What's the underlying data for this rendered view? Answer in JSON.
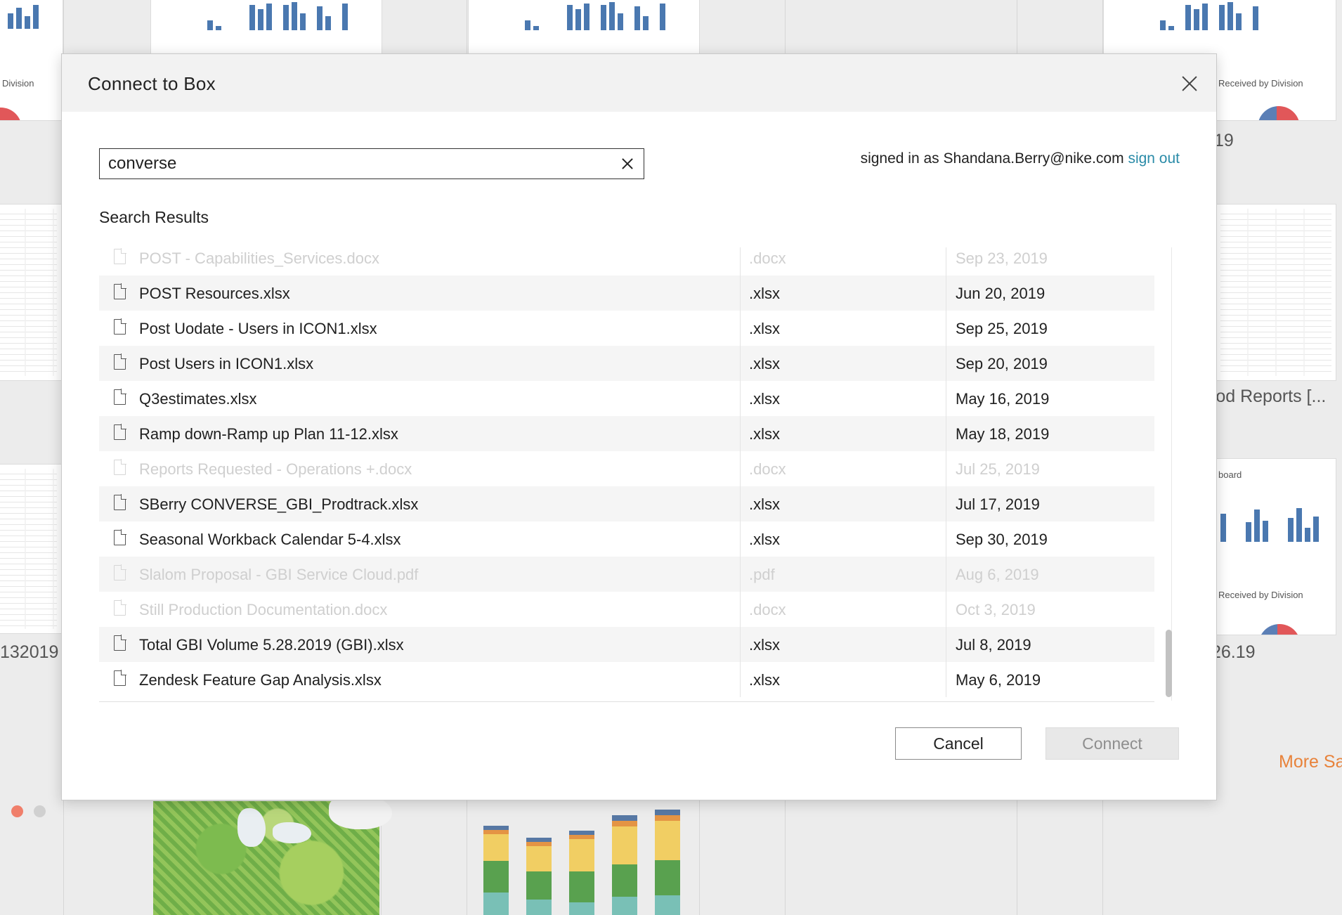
{
  "background": {
    "left_chart_label": "Division",
    "right_chart_label_1": "Received by Division",
    "right_value_1": ".19",
    "right_workbook_label": "rod Reports [...",
    "right_board_label": "board",
    "right_chart_label_2": "Received by Division",
    "right_value_2": "26.19",
    "left_value": "132019",
    "more_samples": "More Sa"
  },
  "dialog": {
    "title": "Connect to Box",
    "close_icon": "close-icon",
    "search": {
      "value": "converse",
      "placeholder": "",
      "clear_icon": "clear-icon"
    },
    "account": {
      "prefix": "signed in as Shandana.Berry@nike.com",
      "sign_out": "sign out"
    },
    "results_label": "Search Results",
    "results": [
      {
        "name": "POST - Capabilities_Services.docx",
        "ext": ".docx",
        "date": "Sep 23, 2019",
        "enabled": false
      },
      {
        "name": "POST Resources.xlsx",
        "ext": ".xlsx",
        "date": "Jun 20, 2019",
        "enabled": true
      },
      {
        "name": "Post Uodate - Users in ICON1.xlsx",
        "ext": ".xlsx",
        "date": "Sep 25, 2019",
        "enabled": true
      },
      {
        "name": "Post Users in ICON1.xlsx",
        "ext": ".xlsx",
        "date": "Sep 20, 2019",
        "enabled": true
      },
      {
        "name": "Q3estimates.xlsx",
        "ext": ".xlsx",
        "date": "May 16, 2019",
        "enabled": true
      },
      {
        "name": "Ramp down-Ramp up Plan 11-12.xlsx",
        "ext": ".xlsx",
        "date": "May 18, 2019",
        "enabled": true
      },
      {
        "name": "Reports Requested - Operations +.docx",
        "ext": ".docx",
        "date": "Jul 25, 2019",
        "enabled": false
      },
      {
        "name": "SBerry CONVERSE_GBI_Prodtrack.xlsx",
        "ext": ".xlsx",
        "date": "Jul 17, 2019",
        "enabled": true
      },
      {
        "name": "Seasonal Workback Calendar 5-4.xlsx",
        "ext": ".xlsx",
        "date": "Sep 30, 2019",
        "enabled": true
      },
      {
        "name": "Slalom Proposal - GBI Service Cloud.pdf",
        "ext": ".pdf",
        "date": "Aug 6, 2019",
        "enabled": false
      },
      {
        "name": "Still Production Documentation.docx",
        "ext": ".docx",
        "date": "Oct 3, 2019",
        "enabled": false
      },
      {
        "name": "Total GBI Volume 5.28.2019 (GBI).xlsx",
        "ext": ".xlsx",
        "date": "Jul 8, 2019",
        "enabled": true
      },
      {
        "name": "Zendesk Feature Gap Analysis.xlsx",
        "ext": ".xlsx",
        "date": "May 6, 2019",
        "enabled": true
      }
    ],
    "buttons": {
      "cancel": "Cancel",
      "connect": "Connect"
    },
    "colors": {
      "link": "#2a8ba8",
      "accent_orange": "#e8823a"
    }
  }
}
